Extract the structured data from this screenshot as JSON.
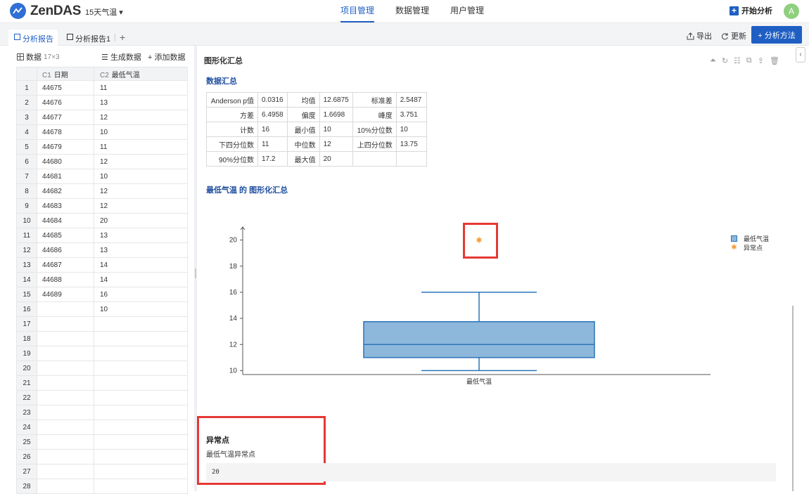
{
  "app": {
    "logo_text": "ZenDAS",
    "project": "15天气温 ▾",
    "nav": [
      "项目管理",
      "数据管理",
      "用户管理"
    ],
    "start_analysis": "开始分析",
    "avatar_letter": "A"
  },
  "tabs": {
    "items": [
      "分析报告",
      "分析报告1"
    ],
    "add": "+",
    "export": "导出",
    "refresh": "更新",
    "analysis_method": "+ 分析方法"
  },
  "data_panel": {
    "title": "数据",
    "size": "17×3",
    "generate": "生成数据",
    "add": "+ 添加数据",
    "columns": [
      {
        "code": "C1",
        "name": "日期"
      },
      {
        "code": "C2",
        "name": "最低气温"
      }
    ],
    "rows": [
      [
        "1",
        "44675",
        "11"
      ],
      [
        "2",
        "44676",
        "13"
      ],
      [
        "3",
        "44677",
        "12"
      ],
      [
        "4",
        "44678",
        "10"
      ],
      [
        "5",
        "44679",
        "11"
      ],
      [
        "6",
        "44680",
        "12"
      ],
      [
        "7",
        "44681",
        "10"
      ],
      [
        "8",
        "44682",
        "12"
      ],
      [
        "9",
        "44683",
        "12"
      ],
      [
        "10",
        "44684",
        "20"
      ],
      [
        "11",
        "44685",
        "13"
      ],
      [
        "12",
        "44686",
        "13"
      ],
      [
        "13",
        "44687",
        "14"
      ],
      [
        "14",
        "44688",
        "14"
      ],
      [
        "15",
        "44689",
        "16"
      ],
      [
        "16",
        "",
        "10"
      ],
      [
        "17",
        "",
        ""
      ],
      [
        "18",
        "",
        ""
      ],
      [
        "19",
        "",
        ""
      ],
      [
        "20",
        "",
        ""
      ],
      [
        "21",
        "",
        ""
      ],
      [
        "22",
        "",
        ""
      ],
      [
        "23",
        "",
        ""
      ],
      [
        "24",
        "",
        ""
      ],
      [
        "25",
        "",
        ""
      ],
      [
        "26",
        "",
        ""
      ],
      [
        "27",
        "",
        ""
      ],
      [
        "28",
        "",
        ""
      ]
    ]
  },
  "report": {
    "title": "图形化汇总",
    "summary_title": "数据汇总",
    "stats": [
      [
        "Anderson p值",
        "0.0316",
        "均值",
        "12.6875",
        "标准差",
        "2.5487"
      ],
      [
        "方差",
        "6.4958",
        "偏度",
        "1.6698",
        "峰度",
        "3.751"
      ],
      [
        "计数",
        "16",
        "最小值",
        "10",
        "10%分位数",
        "10"
      ],
      [
        "下四分位数",
        "11",
        "中位数",
        "12",
        "上四分位数",
        "13.75"
      ],
      [
        "90%分位数",
        "17.2",
        "最大值",
        "20",
        "",
        ""
      ]
    ],
    "chart_title": "最低气温 的 图形化汇总",
    "outlier_title": "异常点",
    "outlier_sub": "最低气温异常点",
    "outlier_value": "20"
  },
  "chart_data": {
    "type": "box",
    "title": "",
    "categories": [
      "最低气温"
    ],
    "ylim": [
      9.7,
      21.0
    ],
    "yticks": [
      10,
      12,
      14,
      16,
      18,
      20
    ],
    "box": {
      "min": 10,
      "q1": 11,
      "median": 12,
      "q3": 13.75,
      "max": 16
    },
    "outliers": [
      20
    ],
    "legend": [
      "最低气温",
      "异常点"
    ],
    "legend_position": "top-right",
    "colors": {
      "box_fill": "#8db7db",
      "box_stroke": "#2b74b8",
      "outlier": "#f39c34"
    }
  }
}
